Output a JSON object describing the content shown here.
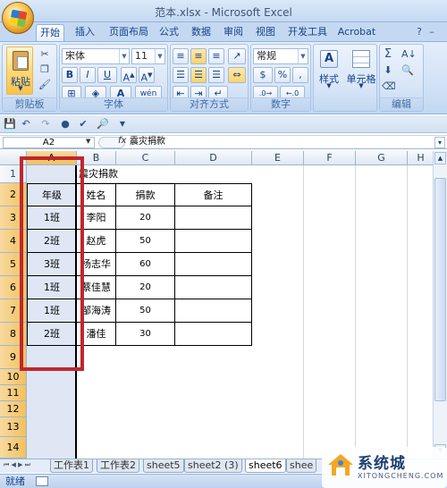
{
  "window": {
    "title": "范本.xlsx - Microsoft Excel"
  },
  "ribbon_tabs": [
    "开始",
    "插入",
    "页面布局",
    "公式",
    "数据",
    "审阅",
    "视图",
    "开发工具",
    "Acrobat"
  ],
  "ribbon": {
    "clipboard": {
      "paste_label": "粘贴",
      "group_label": "剪贴板"
    },
    "font": {
      "font_name": "宋体",
      "font_size": "11",
      "bold": "B",
      "italic": "I",
      "underline": "U",
      "group_label": "字体",
      "wen_label": "wén"
    },
    "alignment": {
      "group_label": "对齐方式"
    },
    "number": {
      "format": "常规",
      "percent": "%",
      "comma": ",",
      "group_label": "数字"
    },
    "styles": {
      "label": "样式"
    },
    "cells": {
      "label": "单元格"
    },
    "editing": {
      "group_label": "编辑"
    }
  },
  "formula_bar": {
    "name_box": "A2",
    "fx": "fx",
    "content": "震灾捐款"
  },
  "columns": [
    "A",
    "B",
    "C",
    "D",
    "E",
    "F",
    "G",
    "H"
  ],
  "rows": [
    "1",
    "2",
    "3",
    "4",
    "5",
    "6",
    "7",
    "8",
    "9",
    "10",
    "11",
    "12",
    "13",
    "14"
  ],
  "sheet": {
    "title_cell": "震灾捐款",
    "headers": [
      "年级",
      "姓名",
      "捐款",
      "备注"
    ],
    "data": [
      [
        "1班",
        "李阳",
        "20",
        ""
      ],
      [
        "2班",
        "赵虎",
        "50",
        ""
      ],
      [
        "3班",
        "杨志华",
        "60",
        ""
      ],
      [
        "1班",
        "蔡佳慧",
        "20",
        ""
      ],
      [
        "1班",
        "邹海涛",
        "50",
        ""
      ],
      [
        "2班",
        "潘佳",
        "30",
        ""
      ]
    ]
  },
  "sheet_tabs": [
    "工作表1",
    "工作表2",
    "sheet5",
    "sheet2 (3)",
    "sheet6",
    "shee"
  ],
  "status": {
    "ready": "就绪"
  },
  "watermark": {
    "text": "系统城",
    "url": "XITONGCHENG.COM"
  },
  "colors": {
    "highlight_box": "#c0272d",
    "selected_header": "#f1c15f",
    "ribbon_blue": "#15428b"
  }
}
